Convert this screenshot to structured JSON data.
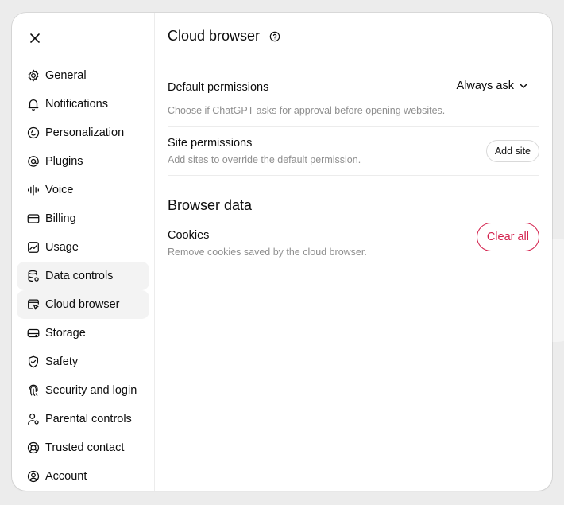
{
  "sidebar": {
    "close_icon": "close-icon",
    "items": [
      {
        "label": "General",
        "icon": "gear-icon"
      },
      {
        "label": "Notifications",
        "icon": "bell-icon"
      },
      {
        "label": "Personalization",
        "icon": "smile-icon"
      },
      {
        "label": "Plugins",
        "icon": "at-icon"
      },
      {
        "label": "Voice",
        "icon": "waveform-icon"
      },
      {
        "label": "Billing",
        "icon": "card-icon"
      },
      {
        "label": "Usage",
        "icon": "chart-icon"
      },
      {
        "label": "Data controls",
        "icon": "database-icon"
      },
      {
        "label": "Cloud browser",
        "icon": "browser-cursor-icon"
      },
      {
        "label": "Storage",
        "icon": "drive-icon"
      },
      {
        "label": "Safety",
        "icon": "shield-icon"
      },
      {
        "label": "Security and login",
        "icon": "fingerprint-icon"
      },
      {
        "label": "Parental controls",
        "icon": "person-gear-icon"
      },
      {
        "label": "Trusted contact",
        "icon": "lifebuoy-icon"
      },
      {
        "label": "Account",
        "icon": "account-icon"
      }
    ]
  },
  "main": {
    "title": "Cloud browser",
    "help_icon": "question-circle-icon",
    "default_permissions": {
      "label": "Default permissions",
      "value": "Always ask",
      "description": "Choose if ChatGPT asks for approval before opening websites."
    },
    "site_permissions": {
      "label": "Site permissions",
      "description": "Add sites to override the default permission.",
      "button": "Add site"
    },
    "browser_data": {
      "title": "Browser data",
      "cookies_label": "Cookies",
      "cookies_description": "Remove cookies saved by the cloud browser.",
      "clear_button": "Clear all"
    }
  },
  "colors": {
    "danger": "#d3204c",
    "active_bg": "#f3f3f3",
    "muted_text": "#8f8f8f"
  }
}
